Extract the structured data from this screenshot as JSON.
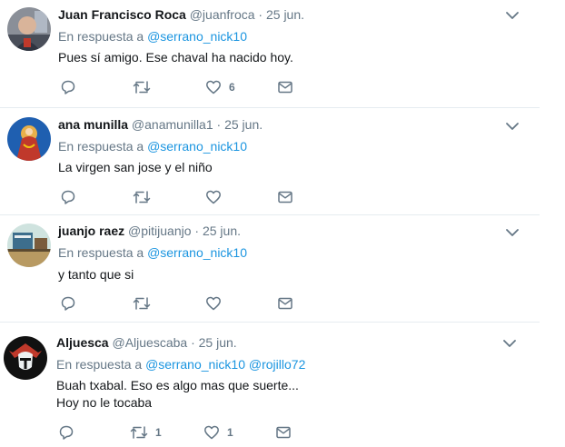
{
  "tweets": [
    {
      "name": "Juan Francisco Roca",
      "handle": "@juanfroca",
      "sep": "·",
      "date": "25 jun.",
      "reply_prefix": "En respuesta a",
      "mentions": [
        "@serrano_nick10"
      ],
      "lines": [
        "Pues sí amigo. Ese chaval ha nacido hoy."
      ],
      "retweets": "",
      "likes": "6"
    },
    {
      "name": "ana munilla",
      "handle": "@anamunilla1",
      "sep": "·",
      "date": "25 jun.",
      "reply_prefix": "En respuesta a",
      "mentions": [
        "@serrano_nick10"
      ],
      "lines": [
        "La virgen san jose y el niño"
      ],
      "retweets": "",
      "likes": ""
    },
    {
      "name": "juanjo raez",
      "handle": "@pitijuanjo",
      "sep": "·",
      "date": "25 jun.",
      "reply_prefix": "En respuesta a",
      "mentions": [
        "@serrano_nick10"
      ],
      "lines": [
        "y tanto que si"
      ],
      "retweets": "",
      "likes": ""
    },
    {
      "name": "Aljuesca",
      "handle": "@Aljuescaba",
      "sep": "·",
      "date": "25 jun.",
      "reply_prefix": "En respuesta a",
      "mentions": [
        "@serrano_nick10",
        "@rojillo72"
      ],
      "lines": [
        "Buah txabal. Eso es algo mas que suerte...",
        "Hoy no le tocaba"
      ],
      "retweets": "1",
      "likes": "1"
    }
  ],
  "icons": {
    "reply": "reply-icon",
    "retweet": "retweet-icon",
    "like": "heart-icon",
    "message": "envelope-icon",
    "menu": "chevron-down-icon"
  },
  "colors": {
    "mention": "#1b95e0",
    "secondary": "#657786",
    "text": "#14171a",
    "divider": "#e6ecf0"
  }
}
